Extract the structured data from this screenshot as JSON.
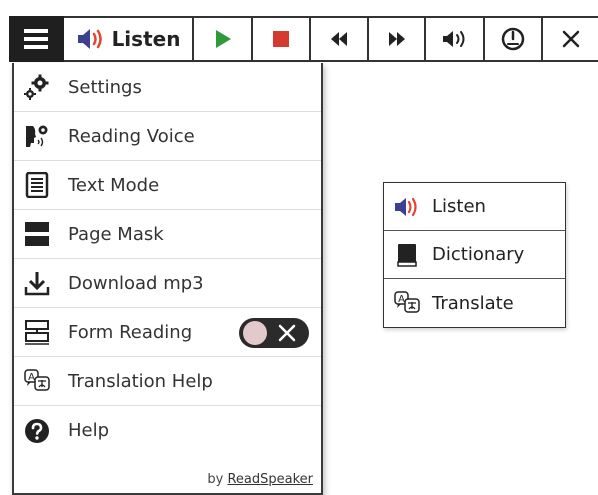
{
  "toolbar": {
    "menu_icon": "hamburger-icon",
    "listen_label": "Listen",
    "buttons": [
      {
        "icon": "play-icon",
        "color": "#2e9a3a"
      },
      {
        "icon": "stop-icon",
        "color": "#d63a2f"
      },
      {
        "icon": "rewind-icon"
      },
      {
        "icon": "fast-forward-icon"
      },
      {
        "icon": "volume-icon"
      },
      {
        "icon": "speed-gauge-icon"
      },
      {
        "icon": "close-icon"
      }
    ]
  },
  "menu": {
    "items": [
      {
        "label": "Settings",
        "icon": "gears-icon"
      },
      {
        "label": "Reading Voice",
        "icon": "voice-settings-icon"
      },
      {
        "label": "Text Mode",
        "icon": "text-document-icon"
      },
      {
        "label": "Page Mask",
        "icon": "page-mask-icon"
      },
      {
        "label": "Download mp3",
        "icon": "download-icon"
      },
      {
        "label": "Form Reading",
        "icon": "form-icon",
        "toggle_on": false
      },
      {
        "label": "Translation Help",
        "icon": "translate-icon"
      },
      {
        "label": "Help",
        "icon": "help-icon"
      }
    ],
    "footer_prefix": "by",
    "footer_brand": "ReadSpeaker"
  },
  "popup": {
    "items": [
      {
        "label": "Listen",
        "icon": "speaker-icon"
      },
      {
        "label": "Dictionary",
        "icon": "book-icon"
      },
      {
        "label": "Translate",
        "icon": "translate-icon"
      }
    ]
  },
  "colors": {
    "speaker_blue": "#3d3f8f",
    "speaker_wave": "#e2452f",
    "play_green": "#2e9a3a",
    "stop_red": "#d63a2f",
    "dark": "#1f1f1f"
  }
}
